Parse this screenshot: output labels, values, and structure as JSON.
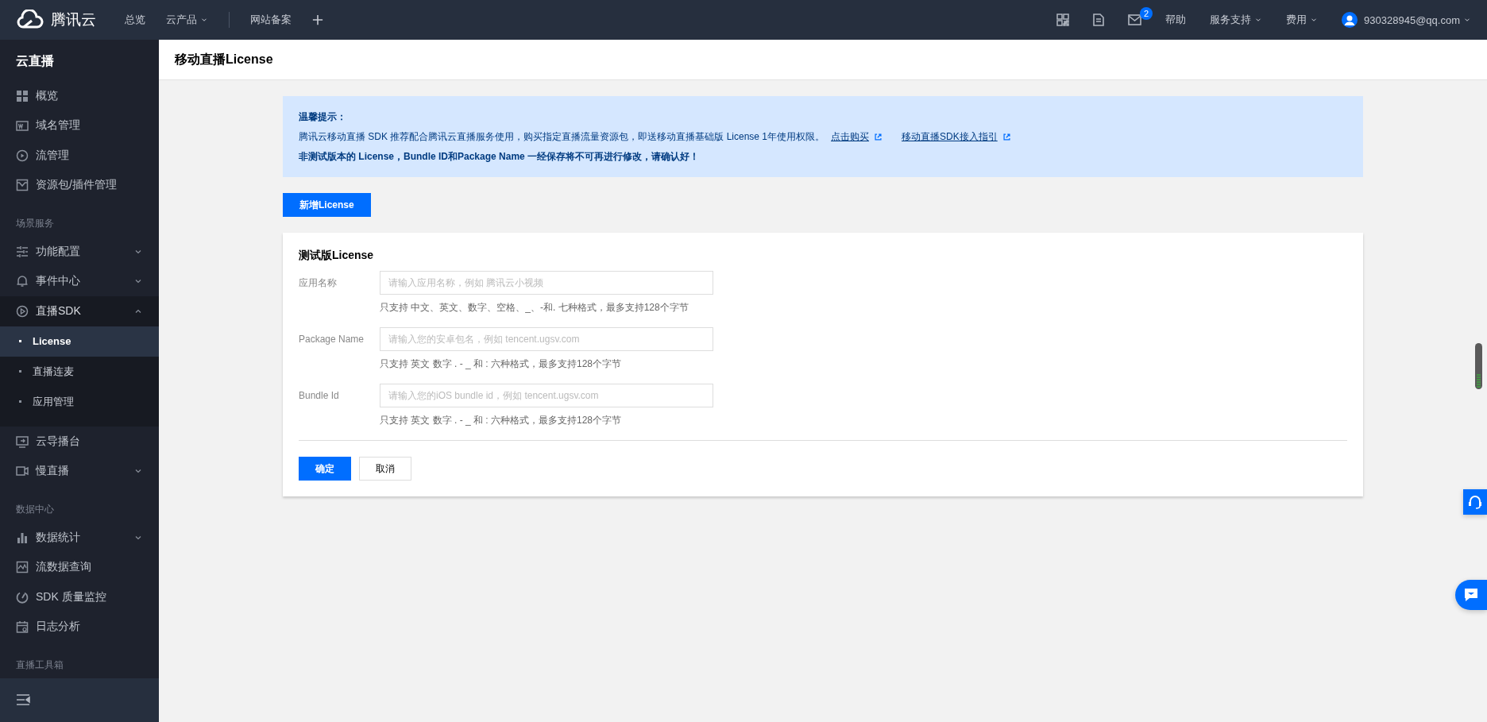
{
  "topbar": {
    "logo": "腾讯云",
    "nav_groups": [
      {
        "items": [
          {
            "label": "总览",
            "dropdown": false
          },
          {
            "label": "云产品",
            "dropdown": true
          }
        ]
      },
      {
        "items": [
          {
            "label": "网站备案",
            "dropdown": false
          }
        ]
      }
    ],
    "mail_badge": "2",
    "links": [
      {
        "label": "帮助",
        "dropdown": false
      },
      {
        "label": "服务支持",
        "dropdown": true
      },
      {
        "label": "费用",
        "dropdown": true
      }
    ],
    "user": "930328945@qq.com"
  },
  "sidebar": {
    "title": "云直播",
    "items": [
      {
        "kind": "link",
        "label": "概览"
      },
      {
        "kind": "link",
        "label": "域名管理"
      },
      {
        "kind": "link",
        "label": "流管理"
      },
      {
        "kind": "link",
        "label": "资源包/插件管理"
      },
      {
        "kind": "section",
        "label": "场景服务"
      },
      {
        "kind": "link",
        "label": "功能配置",
        "expanded": false
      },
      {
        "kind": "link",
        "label": "事件中心",
        "expanded": false
      },
      {
        "kind": "link",
        "label": "直播SDK",
        "expanded": true,
        "children": [
          {
            "label": "License",
            "selected": true
          },
          {
            "label": "直播连麦",
            "selected": false
          },
          {
            "label": "应用管理",
            "selected": false
          }
        ]
      },
      {
        "kind": "link",
        "label": "云导播台"
      },
      {
        "kind": "link",
        "label": "慢直播",
        "expanded": false
      },
      {
        "kind": "section",
        "label": "数据中心"
      },
      {
        "kind": "link",
        "label": "数据统计",
        "expanded": false
      },
      {
        "kind": "link",
        "label": "流数据查询"
      },
      {
        "kind": "link",
        "label": "SDK 质量监控"
      },
      {
        "kind": "link",
        "label": "日志分析"
      },
      {
        "kind": "section",
        "label": "直播工具箱"
      }
    ]
  },
  "page": {
    "title": "移动直播License"
  },
  "notice": {
    "title": "温馨提示：",
    "text": "腾讯云移动直播 SDK 推荐配合腾讯云直播服务使用，购买指定直播流量资源包，即送移动直播基础版 License 1年使用权限。",
    "links": [
      "点击购买",
      "移动直播SDK接入指引"
    ],
    "warning": "非测试版本的 License，Bundle ID和Package Name 一经保存将不可再进行修改，请确认好！"
  },
  "add_button": "新增License",
  "form": {
    "title": "测试版License",
    "fields": [
      {
        "label": "应用名称",
        "placeholder": "请输入应用名称，例如 腾讯云小视频",
        "hint": "只支持 中文、英文、数字、空格、_、-和. 七种格式，最多支持128个字节"
      },
      {
        "label": "Package Name",
        "placeholder": "请输入您的安卓包名，例如 tencent.ugsv.com",
        "hint": "只支持 英文 数字 . - _ 和 : 六种格式，最多支持128个字节"
      },
      {
        "label": "Bundle Id",
        "placeholder": "请输入您的iOS bundle id，例如 tencent.ugsv.com",
        "hint": "只支持 英文 数字 . - _ 和 : 六种格式，最多支持128个字节"
      }
    ],
    "buttons": [
      {
        "label": "确定",
        "kind": "primary"
      },
      {
        "label": "取消",
        "kind": "default"
      }
    ]
  }
}
